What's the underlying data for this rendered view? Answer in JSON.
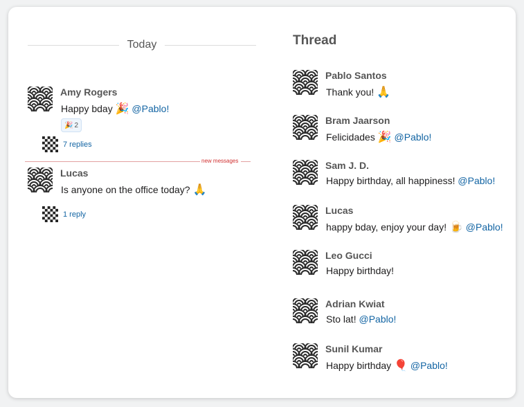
{
  "channel": {
    "day_label": "Today",
    "new_messages_label": "new messages",
    "messages": [
      {
        "author": "Amy Rogers",
        "text": "Happy bday",
        "emoji": "🎉",
        "mention": "@Pablo!",
        "reaction": {
          "emoji": "🎉",
          "count": "2"
        },
        "replies": "7 replies"
      },
      {
        "author": "Lucas",
        "text": "Is anyone on the office today?",
        "emoji": "🙏",
        "replies": "1 reply"
      }
    ]
  },
  "thread": {
    "title": "Thread",
    "messages": [
      {
        "author": "Pablo Santos",
        "text": "Thank you!",
        "emoji": "🙏",
        "mention": ""
      },
      {
        "author": "Bram Jaarson",
        "text": "Felicidades",
        "emoji": "🎉",
        "mention": "@Pablo!"
      },
      {
        "author": "Sam J. D.",
        "text": "Happy birthday, all happiness!",
        "emoji": "",
        "mention": "@Pablo!"
      },
      {
        "author": "Lucas",
        "text": "happy bday, enjoy your day!",
        "emoji": "🍺",
        "mention": "@Pablo!"
      },
      {
        "author": "Leo Gucci",
        "text": "Happy birthday!",
        "emoji": "",
        "mention": ""
      },
      {
        "author": "Adrian Kwiat",
        "text": "Sto lat!",
        "emoji": "",
        "mention": "@Pablo!"
      },
      {
        "author": "Sunil Kumar",
        "text": "Happy birthday",
        "emoji": "🎈",
        "mention": "@Pablo!"
      }
    ]
  }
}
